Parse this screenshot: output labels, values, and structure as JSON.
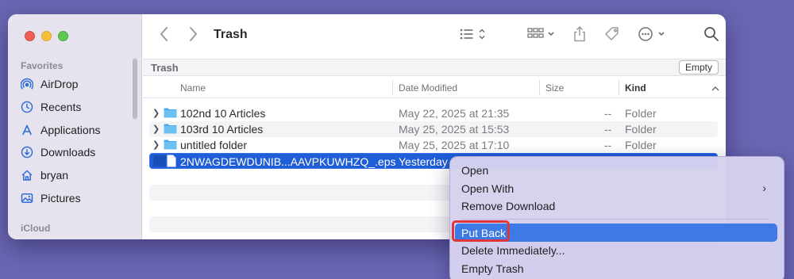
{
  "window": {
    "title": "Trash"
  },
  "sidebar": {
    "favorites_label": "Favorites",
    "icloud_label": "iCloud",
    "items": [
      {
        "label": "AirDrop",
        "icon": "airdrop-icon"
      },
      {
        "label": "Recents",
        "icon": "clock-icon"
      },
      {
        "label": "Applications",
        "icon": "applications-icon"
      },
      {
        "label": "Downloads",
        "icon": "download-icon"
      },
      {
        "label": "bryan",
        "icon": "home-icon"
      },
      {
        "label": "Pictures",
        "icon": "photo-icon"
      }
    ]
  },
  "path_bar": {
    "label": "Trash",
    "empty_button": "Empty"
  },
  "columns": {
    "name": "Name",
    "date": "Date Modified",
    "size": "Size",
    "kind": "Kind"
  },
  "files": [
    {
      "name": "102nd 10 Articles",
      "date": "May 22, 2025 at 21:35",
      "size": "--",
      "kind": "Folder"
    },
    {
      "name": "103rd 10 Articles",
      "date": "May 25, 2025 at 15:53",
      "size": "--",
      "kind": "Folder"
    },
    {
      "name": "untitled folder",
      "date": "May 25, 2025 at 17:10",
      "size": "--",
      "kind": "Folder"
    },
    {
      "name": "2NWAGDEWDUNIB...AAVPKUWHZQ_.eps",
      "date": "Yesterday",
      "size": "",
      "kind": ""
    }
  ],
  "context_menu": {
    "items": [
      "Open",
      "Open With",
      "Remove Download",
      "Put Back",
      "Delete Immediately...",
      "Empty Trash"
    ],
    "submenu_arrow": "›",
    "highlighted": "Put Back"
  },
  "colors": {
    "selection": "#1f5ed6",
    "menu_highlight": "#3d7ae6",
    "annotation": "#e0353a",
    "folder": "#4aa9e8"
  }
}
